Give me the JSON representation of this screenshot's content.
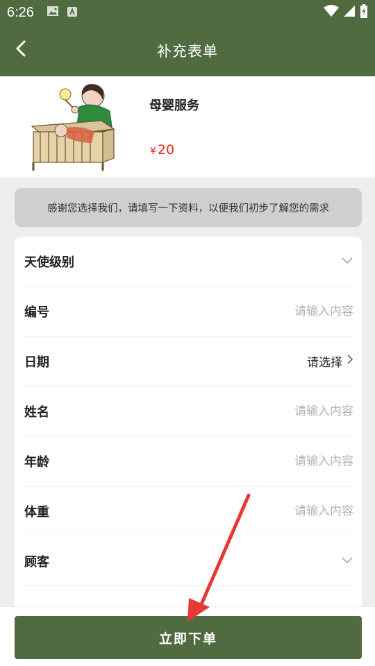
{
  "status_bar": {
    "time": "6:26"
  },
  "header": {
    "title": "补充表单",
    "back_icon": "chevron-left-icon"
  },
  "product": {
    "name": "母婴服务",
    "currency": "¥",
    "price": "20"
  },
  "notice": {
    "text": "感谢您选择我们，请填写一下资料，以便我们初步了解您的需求"
  },
  "form": {
    "fields": [
      {
        "label": "天使级别",
        "type": "dropdown"
      },
      {
        "label": "编号",
        "type": "input",
        "placeholder": "请输入内容"
      },
      {
        "label": "日期",
        "type": "picker",
        "value": "请选择"
      },
      {
        "label": "姓名",
        "type": "input",
        "placeholder": "请输入内容"
      },
      {
        "label": "年龄",
        "type": "input",
        "placeholder": "请输入内容"
      },
      {
        "label": "体重",
        "type": "input",
        "placeholder": "请输入内容"
      },
      {
        "label": "顾客",
        "type": "dropdown"
      }
    ]
  },
  "footer": {
    "submit_label": "立即下单"
  },
  "colors": {
    "primary": "#516b40",
    "price": "#e8261c",
    "annotation_arrow": "#e53935"
  }
}
